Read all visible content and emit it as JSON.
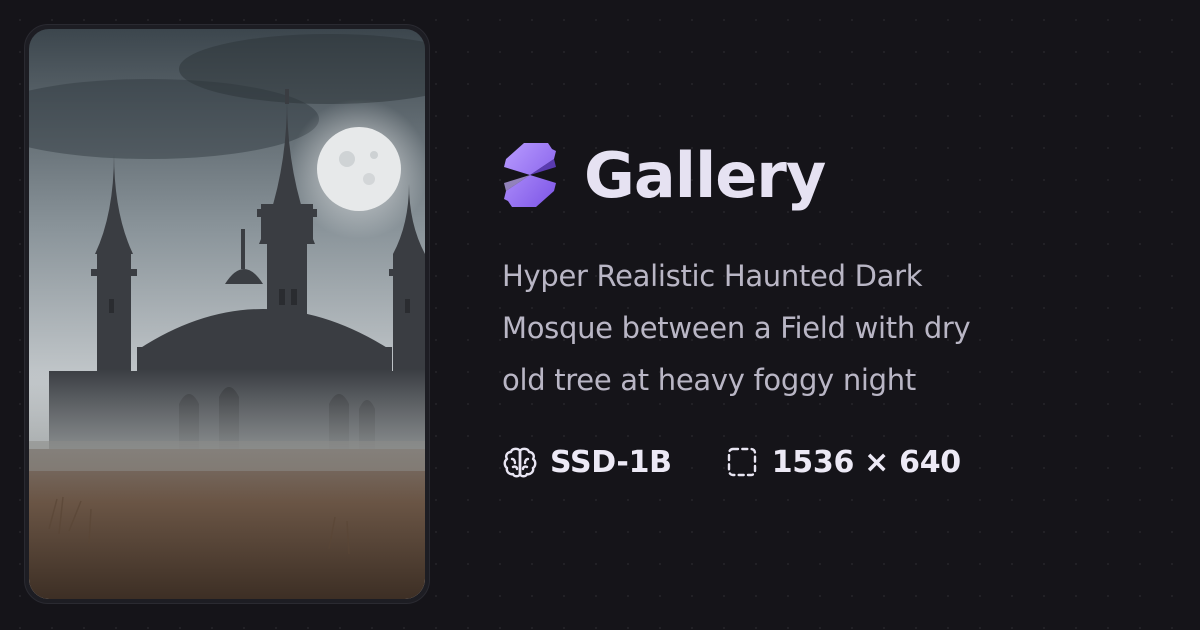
{
  "app": {
    "title": "Gallery",
    "logo_icon": "gallery-logo-icon",
    "accent_color": "#9b7cf0"
  },
  "image": {
    "alt": "Hyper Realistic Haunted Dark Mosque between a Field with dry old tree at heavy foggy night"
  },
  "prompt": {
    "lines": [
      "Hyper Realistic Haunted Dark",
      "Mosque between a Field with dry",
      "old tree at heavy foggy night"
    ]
  },
  "meta": {
    "model": {
      "icon": "brain-icon",
      "label": "SSD-1B"
    },
    "size": {
      "icon": "dashed-frame-icon",
      "label": "1536 × 640"
    }
  }
}
